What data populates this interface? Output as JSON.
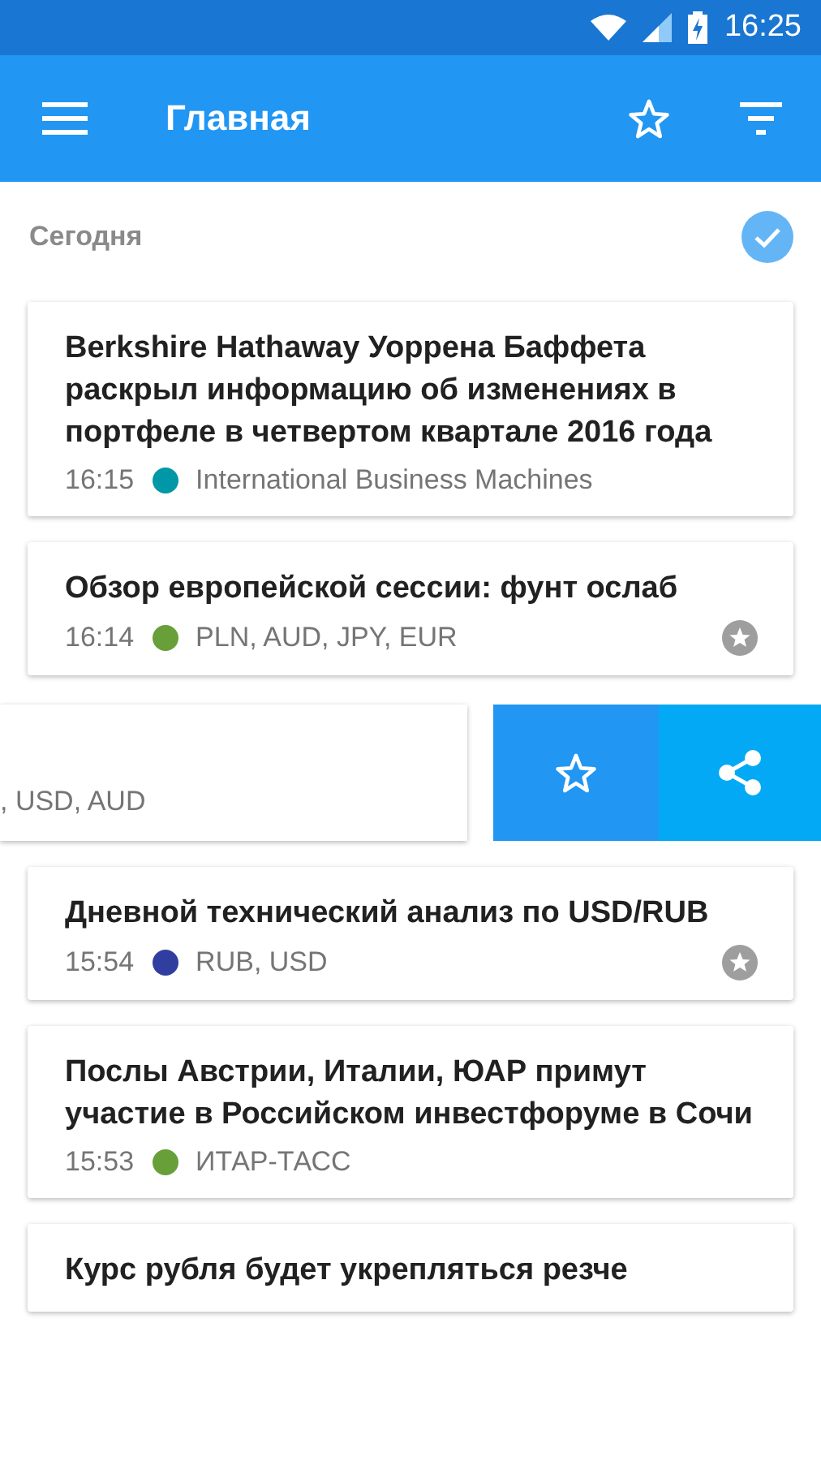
{
  "status_bar": {
    "time": "16:25"
  },
  "toolbar": {
    "title": "Главная"
  },
  "section": {
    "label": "Сегодня",
    "checked": true
  },
  "items": [
    {
      "kind": "card",
      "title": "Berkshire Hathaway Уоррена Баффета раскрыл информацию об изменениях в портфеле в четвертом квартале 2016 года",
      "time": "16:15",
      "color": "#0097a7",
      "source": "International Business Machines",
      "starred": false
    },
    {
      "kind": "card",
      "title": "Обзор европейской сессии: фунт ослаб",
      "time": "16:14",
      "color": "#689f38",
      "source": "PLN, AUD, JPY, EUR",
      "starred": true
    },
    {
      "kind": "swiped",
      "source": ", USD, AUD"
    },
    {
      "kind": "card",
      "title": "Дневной технический анализ по USD/RUB",
      "time": "15:54",
      "color": "#303f9f",
      "source": "RUB, USD",
      "starred": true
    },
    {
      "kind": "card",
      "title": "Послы Австрии, Италии, ЮАР примут участие в Российском   инвестфоруме в Сочи",
      "time": "15:53",
      "color": "#689f38",
      "source": "ИТАР-ТАСС",
      "starred": false
    },
    {
      "kind": "cut",
      "title": "Курс рубля будет укрепляться резче"
    }
  ]
}
